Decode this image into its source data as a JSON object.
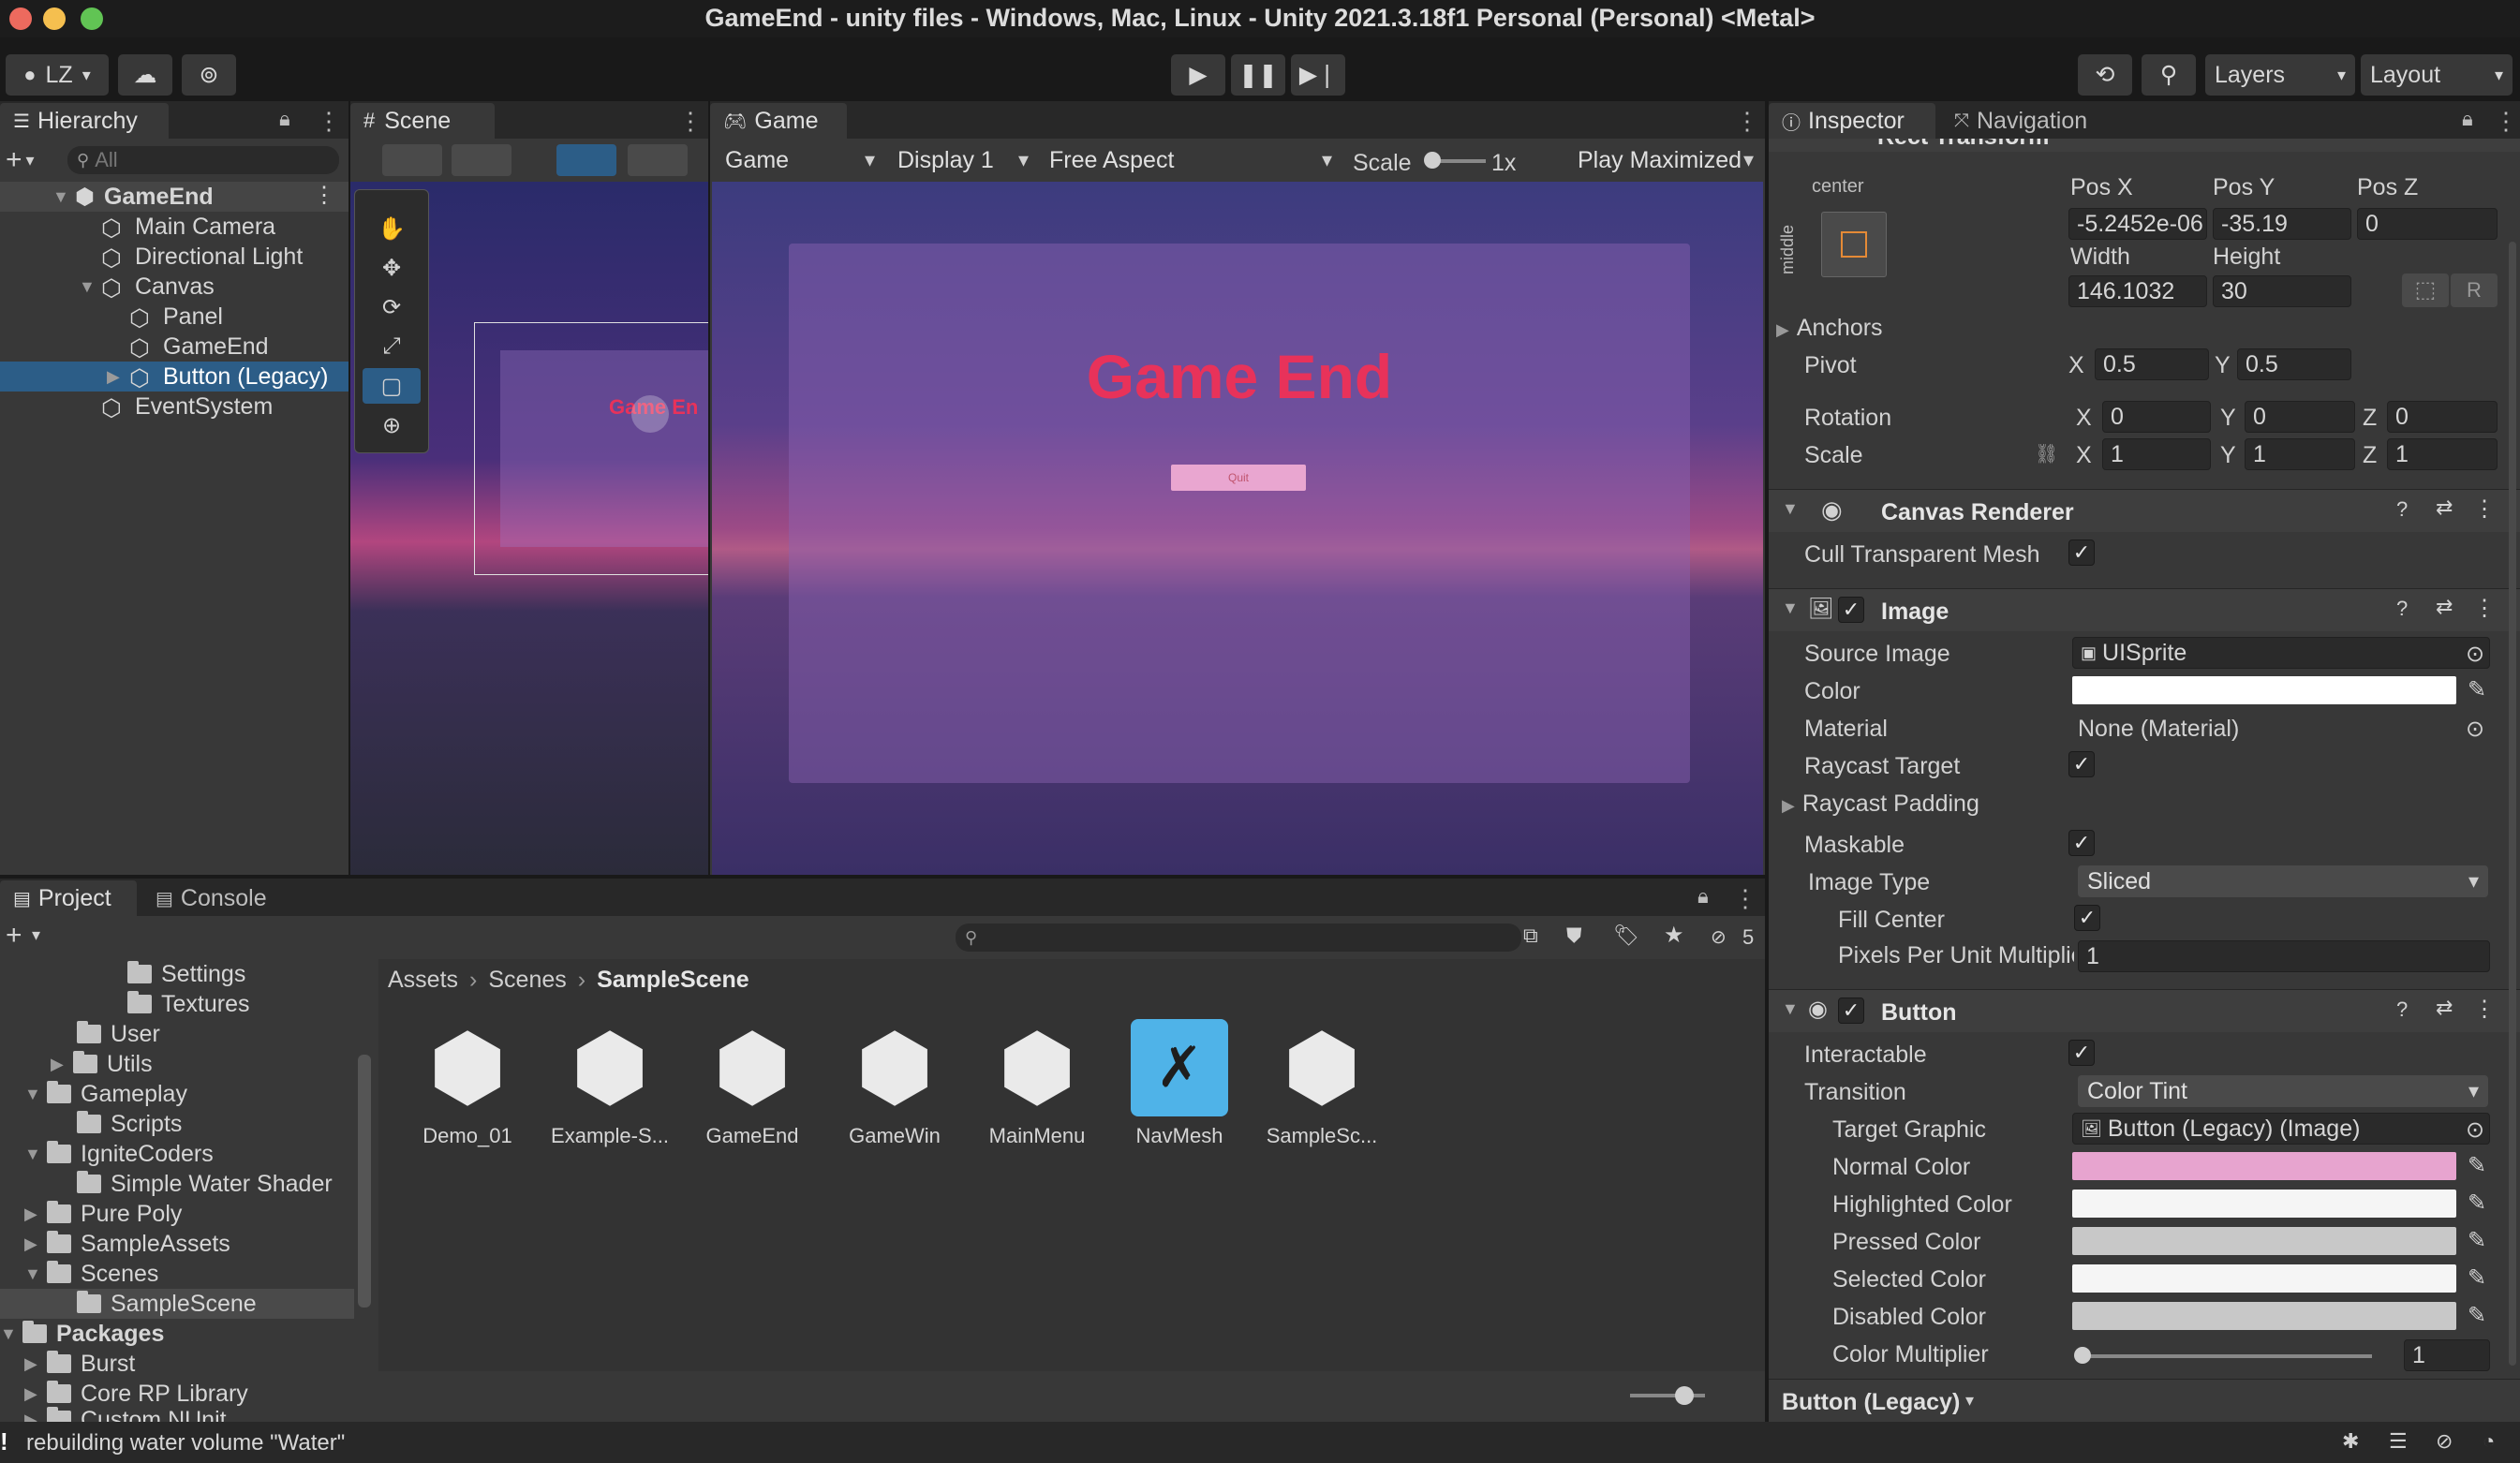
{
  "window": {
    "title": "GameEnd - unity files - Windows, Mac, Linux - Unity 2021.3.18f1 Personal (Personal) <Metal>"
  },
  "toolbar": {
    "account": "LZ",
    "layers": "Layers",
    "layout": "Layout"
  },
  "hierarchy": {
    "tab": "Hierarchy",
    "search_placeholder": "All",
    "items": [
      {
        "label": "GameEnd"
      },
      {
        "label": "Main Camera"
      },
      {
        "label": "Directional Light"
      },
      {
        "label": "Canvas"
      },
      {
        "label": "Panel"
      },
      {
        "label": "GameEnd"
      },
      {
        "label": "Button (Legacy)"
      },
      {
        "label": "EventSystem"
      }
    ]
  },
  "scene": {
    "tab": "Scene",
    "preview_text": "Game En"
  },
  "game": {
    "tab": "Game",
    "view_mode": "Game",
    "display": "Display 1",
    "aspect": "Free Aspect",
    "scale_label": "Scale",
    "scale_value": "1x",
    "play_mode": "Play Maximized",
    "headline": "Game End",
    "button_text": "Quit",
    "colors": {
      "headline": "#e8325a",
      "button": "#e9a6d0"
    }
  },
  "project": {
    "tab": "Project",
    "console_tab": "Console",
    "hidden_count": "5",
    "breadcrumb": [
      "Assets",
      "Scenes",
      "SampleScene"
    ],
    "tree": [
      {
        "label": "Settings"
      },
      {
        "label": "Textures"
      },
      {
        "label": "User"
      },
      {
        "label": "Utils"
      },
      {
        "label": "Gameplay"
      },
      {
        "label": "Scripts"
      },
      {
        "label": "IgniteCoders"
      },
      {
        "label": "Simple Water Shader"
      },
      {
        "label": "Pure Poly"
      },
      {
        "label": "SampleAssets"
      },
      {
        "label": "Scenes"
      },
      {
        "label": "SampleScene"
      },
      {
        "label": "Packages"
      },
      {
        "label": "Burst"
      },
      {
        "label": "Core RP Library"
      },
      {
        "label": "Custom NUnit"
      }
    ],
    "assets": [
      {
        "label": "Demo_01",
        "icon": "unity-scene-icon"
      },
      {
        "label": "Example-S...",
        "icon": "unity-scene-icon"
      },
      {
        "label": "GameEnd",
        "icon": "unity-scene-icon"
      },
      {
        "label": "GameWin",
        "icon": "unity-scene-icon"
      },
      {
        "label": "MainMenu",
        "icon": "unity-scene-icon"
      },
      {
        "label": "NavMesh",
        "icon": "navmesh-icon"
      },
      {
        "label": "SampleSc...",
        "icon": "unity-scene-icon"
      }
    ]
  },
  "inspector": {
    "tab": "Inspector",
    "nav_tab": "Navigation",
    "rect": {
      "title": "Rect Transform",
      "anchor_h": "center",
      "anchor_v": "middle",
      "posx_label": "Pos X",
      "posx": "-5.2452e-06",
      "posy_label": "Pos Y",
      "posy": "-35.19",
      "posz_label": "Pos Z",
      "posz": "0",
      "width_label": "Width",
      "width": "146.1032",
      "height_label": "Height",
      "height": "30",
      "r_label": "R",
      "anchors": "Anchors",
      "pivot": "Pivot",
      "pivot_x": "0.5",
      "pivot_y": "0.5",
      "rotation": "Rotation",
      "rot_x": "0",
      "rot_y": "0",
      "rot_z": "0",
      "scale": "Scale",
      "scale_x": "1",
      "scale_y": "1",
      "scale_z": "1",
      "x": "X",
      "y": "Y",
      "z": "Z"
    },
    "canvas_renderer": {
      "title": "Canvas Renderer",
      "cull": "Cull Transparent Mesh"
    },
    "image": {
      "title": "Image",
      "source_image_label": "Source Image",
      "source_image": "UISprite",
      "color_label": "Color",
      "color": "#ffffff",
      "material_label": "Material",
      "material": "None (Material)",
      "raycast_target": "Raycast Target",
      "raycast_padding": "Raycast Padding",
      "maskable": "Maskable",
      "image_type_label": "Image Type",
      "image_type": "Sliced",
      "fill_center": "Fill Center",
      "ppu_label": "Pixels Per Unit Multiplier",
      "ppu": "1"
    },
    "button": {
      "title": "Button",
      "interactable": "Interactable",
      "transition_label": "Transition",
      "transition": "Color Tint",
      "target_graphic_label": "Target Graphic",
      "target_graphic": "Button (Legacy) (Image)",
      "normal_label": "Normal Color",
      "normal": "#e7a4cf",
      "highlighted_label": "Highlighted Color",
      "highlighted": "#f5f5f5",
      "pressed_label": "Pressed Color",
      "pressed": "#c8c8c8",
      "selected_label": "Selected Color",
      "selected": "#f5f5f5",
      "disabled_label": "Disabled Color",
      "disabled": "#c8c8c8",
      "multiplier_label": "Color Multiplier",
      "multiplier": "1"
    },
    "footer": "Button (Legacy)"
  },
  "status": {
    "message": "rebuilding water volume \"Water\""
  }
}
